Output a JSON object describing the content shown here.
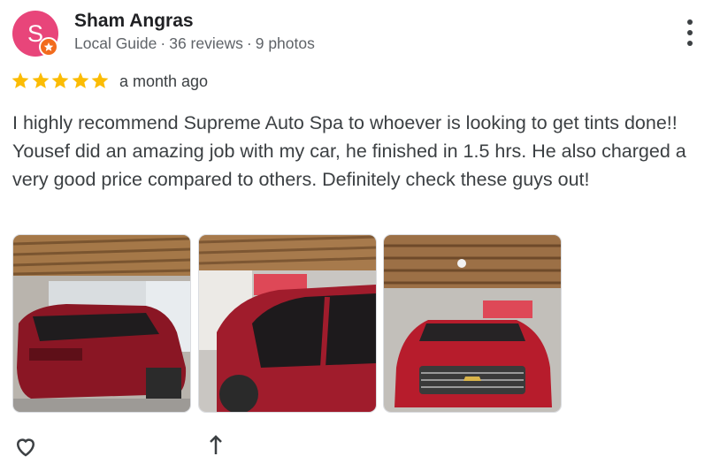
{
  "reviewer": {
    "initial": "S",
    "name": "Sham Angras",
    "badge": "Local Guide",
    "reviews": "36 reviews",
    "photos": "9 photos",
    "separator": "·",
    "avatar_color": "#e8457a",
    "badge_color": "#f26b1d"
  },
  "rating": {
    "stars": 5,
    "max": 5,
    "star_color": "#fbbc04",
    "time_ago": "a month ago"
  },
  "review_text": "I highly recommend Supreme Auto Spa to whoever is looking to get tints done!! Yousef did an amazing job with my car, he finished in 1.5 hrs. He also charged a very good price compared to others. Definitely check these guys out!",
  "photos": [
    {
      "subject": "red SUV rear view in garage"
    },
    {
      "subject": "red SUV side windows"
    },
    {
      "subject": "red SUV front view with Chevrolet grille"
    }
  ],
  "actions": {
    "like_icon": "heart-icon",
    "share_icon": "share-icon"
  },
  "icons": {
    "more": "more-vert-icon",
    "star": "star-icon",
    "badge": "local-guide-star-icon"
  }
}
